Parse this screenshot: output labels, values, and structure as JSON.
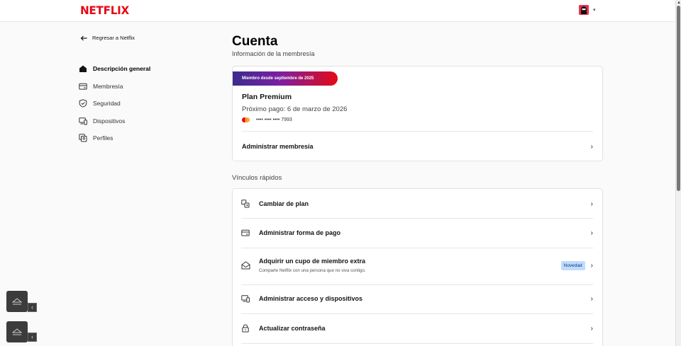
{
  "header": {
    "logo_text": "NETFLIX",
    "brand_color": "#e50914",
    "avatar_icon": "profile-avatar-icon",
    "menu_caret": "▾"
  },
  "sidebar": {
    "back_label": "Regresar a Netflix",
    "items": [
      {
        "label": "Descripción general",
        "icon": "home-icon",
        "active": true
      },
      {
        "label": "Membresía",
        "icon": "card-icon",
        "active": false
      },
      {
        "label": "Seguridad",
        "icon": "shield-icon",
        "active": false
      },
      {
        "label": "Dispositivos",
        "icon": "devices-icon",
        "active": false
      },
      {
        "label": "Perfiles",
        "icon": "profiles-icon",
        "active": false
      }
    ]
  },
  "main": {
    "title": "Cuenta",
    "subtitle": "Información de la membresía",
    "membership": {
      "badge": "Miembro desde septiembre de 2025",
      "plan": "Plan Premium",
      "next_payment": "Próximo pago: 6 de marzo de 2026",
      "card_masked": "•••• •••• •••• 7993",
      "manage_label": "Administrar membresía"
    },
    "quick_links": {
      "title": "Vínculos rápidos",
      "items": [
        {
          "label": "Cambiar de plan",
          "icon": "change-plan-icon",
          "description": "",
          "badge": ""
        },
        {
          "label": "Administrar forma de pago",
          "icon": "payment-card-icon",
          "description": "",
          "badge": ""
        },
        {
          "label": "Adquirir un cupo de miembro extra",
          "icon": "extra-member-icon",
          "description": "Comparte Netflix con una persona que no viva contigo.",
          "badge": "Novedad"
        },
        {
          "label": "Administrar acceso y dispositivos",
          "icon": "devices-icon",
          "description": "",
          "badge": ""
        },
        {
          "label": "Actualizar contraseña",
          "icon": "lock-icon",
          "description": "",
          "badge": ""
        }
      ]
    }
  },
  "chevron": "›"
}
